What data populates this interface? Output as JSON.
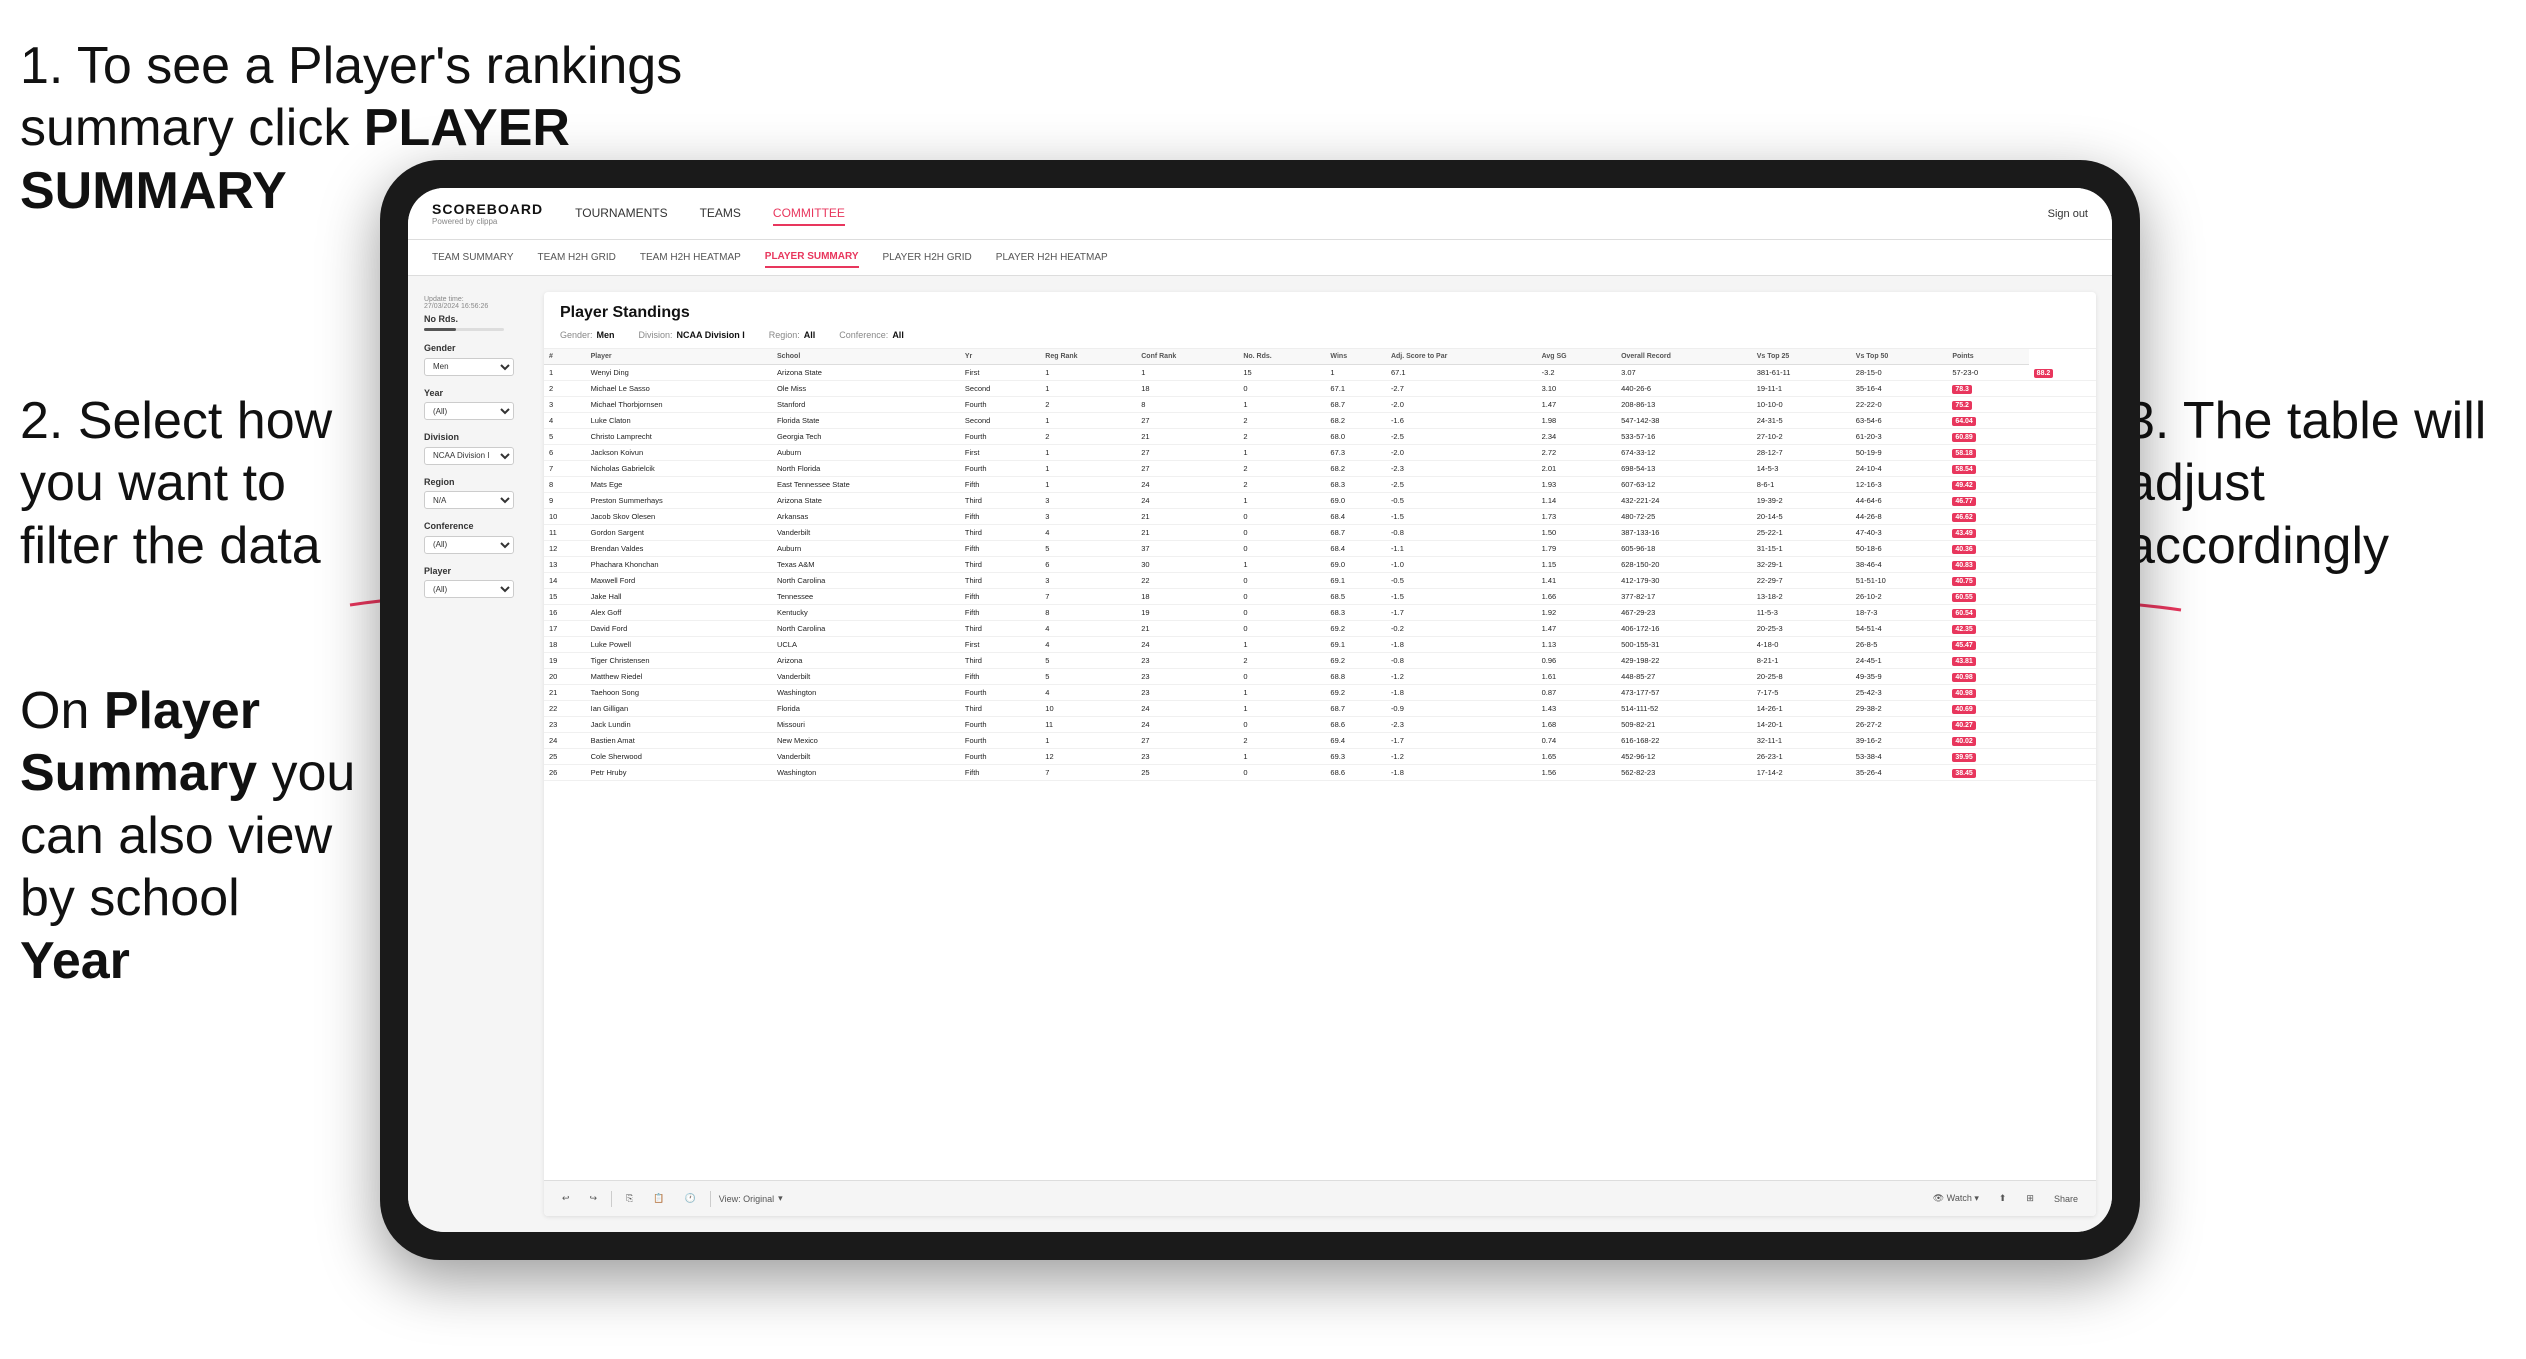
{
  "instructions": {
    "step1": "1. To see a Player's rankings summary click ",
    "step1_bold": "PLAYER SUMMARY",
    "step2_line1": "2. Select how you want to",
    "step2_line2": "filter the data",
    "step3": "3. The table will adjust accordingly",
    "step4_line1": "On ",
    "step4_bold1": "Player Summary",
    "step4_line2": " you can also view by school ",
    "step4_bold2": "Year"
  },
  "nav": {
    "logo": "SCOREBOARD",
    "logo_sub": "Powered by clippa",
    "links": [
      "TOURNAMENTS",
      "TEAMS",
      "COMMITTEE"
    ],
    "sign_out": "Sign out"
  },
  "sub_nav": {
    "links": [
      "TEAM SUMMARY",
      "TEAM H2H GRID",
      "TEAM H2H HEATMAP",
      "PLAYER SUMMARY",
      "PLAYER H2H GRID",
      "PLAYER H2H HEATMAP"
    ],
    "active": "PLAYER SUMMARY"
  },
  "update_time": {
    "label": "Update time:",
    "value": "27/03/2024 16:56:26"
  },
  "table": {
    "title": "Player Standings",
    "filters": {
      "gender_label": "Gender:",
      "gender_value": "Men",
      "division_label": "Division:",
      "division_value": "NCAA Division I",
      "region_label": "Region:",
      "region_value": "All",
      "conference_label": "Conference:",
      "conference_value": "All"
    },
    "columns": [
      "#",
      "Player",
      "School",
      "Yr",
      "Reg Rank",
      "Conf Rank",
      "No. Rds.",
      "Wins",
      "Adj. Score to Par",
      "Avg SG",
      "Overall Record",
      "Vs Top 25",
      "Vs Top 50",
      "Points"
    ],
    "rows": [
      [
        "1",
        "Wenyi Ding",
        "Arizona State",
        "First",
        "1",
        "1",
        "15",
        "1",
        "67.1",
        "-3.2",
        "3.07",
        "381-61-11",
        "28-15-0",
        "57-23-0",
        "88.2"
      ],
      [
        "2",
        "Michael Le Sasso",
        "Ole Miss",
        "Second",
        "1",
        "18",
        "0",
        "67.1",
        "-2.7",
        "3.10",
        "440-26-6",
        "19-11-1",
        "35-16-4",
        "78.3"
      ],
      [
        "3",
        "Michael Thorbjornsen",
        "Stanford",
        "Fourth",
        "2",
        "8",
        "1",
        "68.7",
        "-2.0",
        "1.47",
        "208-86-13",
        "10-10-0",
        "22-22-0",
        "75.2"
      ],
      [
        "4",
        "Luke Claton",
        "Florida State",
        "Second",
        "1",
        "27",
        "2",
        "68.2",
        "-1.6",
        "1.98",
        "547-142-38",
        "24-31-5",
        "63-54-6",
        "64.04"
      ],
      [
        "5",
        "Christo Lamprecht",
        "Georgia Tech",
        "Fourth",
        "2",
        "21",
        "2",
        "68.0",
        "-2.5",
        "2.34",
        "533-57-16",
        "27-10-2",
        "61-20-3",
        "60.89"
      ],
      [
        "6",
        "Jackson Koivun",
        "Auburn",
        "First",
        "1",
        "27",
        "1",
        "67.3",
        "-2.0",
        "2.72",
        "674-33-12",
        "28-12-7",
        "50-19-9",
        "58.18"
      ],
      [
        "7",
        "Nicholas Gabrielcik",
        "North Florida",
        "Fourth",
        "1",
        "27",
        "2",
        "68.2",
        "-2.3",
        "2.01",
        "698-54-13",
        "14-5-3",
        "24-10-4",
        "58.54"
      ],
      [
        "8",
        "Mats Ege",
        "East Tennessee State",
        "Fifth",
        "1",
        "24",
        "2",
        "68.3",
        "-2.5",
        "1.93",
        "607-63-12",
        "8-6-1",
        "12-16-3",
        "49.42"
      ],
      [
        "9",
        "Preston Summerhays",
        "Arizona State",
        "Third",
        "3",
        "24",
        "1",
        "69.0",
        "-0.5",
        "1.14",
        "432-221-24",
        "19-39-2",
        "44-64-6",
        "46.77"
      ],
      [
        "10",
        "Jacob Skov Olesen",
        "Arkansas",
        "Fifth",
        "3",
        "21",
        "0",
        "68.4",
        "-1.5",
        "1.73",
        "480-72-25",
        "20-14-5",
        "44-26-8",
        "46.62"
      ],
      [
        "11",
        "Gordon Sargent",
        "Vanderbilt",
        "Third",
        "4",
        "21",
        "0",
        "68.7",
        "-0.8",
        "1.50",
        "387-133-16",
        "25-22-1",
        "47-40-3",
        "43.49"
      ],
      [
        "12",
        "Brendan Valdes",
        "Auburn",
        "Fifth",
        "5",
        "37",
        "0",
        "68.4",
        "-1.1",
        "1.79",
        "605-96-18",
        "31-15-1",
        "50-18-6",
        "40.36"
      ],
      [
        "13",
        "Phachara Khonchan",
        "Texas A&M",
        "Third",
        "6",
        "30",
        "1",
        "69.0",
        "-1.0",
        "1.15",
        "628-150-20",
        "32-29-1",
        "38-46-4",
        "40.83"
      ],
      [
        "14",
        "Maxwell Ford",
        "North Carolina",
        "Third",
        "3",
        "22",
        "0",
        "69.1",
        "-0.5",
        "1.41",
        "412-179-30",
        "22-29-7",
        "51-51-10",
        "40.75"
      ],
      [
        "15",
        "Jake Hall",
        "Tennessee",
        "Fifth",
        "7",
        "18",
        "0",
        "68.5",
        "-1.5",
        "1.66",
        "377-82-17",
        "13-18-2",
        "26-10-2",
        "60.55"
      ],
      [
        "16",
        "Alex Goff",
        "Kentucky",
        "Fifth",
        "8",
        "19",
        "0",
        "68.3",
        "-1.7",
        "1.92",
        "467-29-23",
        "11-5-3",
        "18-7-3",
        "60.54"
      ],
      [
        "17",
        "David Ford",
        "North Carolina",
        "Third",
        "4",
        "21",
        "0",
        "69.2",
        "-0.2",
        "1.47",
        "406-172-16",
        "20-25-3",
        "54-51-4",
        "42.35"
      ],
      [
        "18",
        "Luke Powell",
        "UCLA",
        "First",
        "4",
        "24",
        "1",
        "69.1",
        "-1.8",
        "1.13",
        "500-155-31",
        "4-18-0",
        "26-8-5",
        "45.47"
      ],
      [
        "19",
        "Tiger Christensen",
        "Arizona",
        "Third",
        "5",
        "23",
        "2",
        "69.2",
        "-0.8",
        "0.96",
        "429-198-22",
        "8-21-1",
        "24-45-1",
        "43.81"
      ],
      [
        "20",
        "Matthew Riedel",
        "Vanderbilt",
        "Fifth",
        "5",
        "23",
        "0",
        "68.8",
        "-1.2",
        "1.61",
        "448-85-27",
        "20-25-8",
        "49-35-9",
        "40.98"
      ],
      [
        "21",
        "Taehoon Song",
        "Washington",
        "Fourth",
        "4",
        "23",
        "1",
        "69.2",
        "-1.8",
        "0.87",
        "473-177-57",
        "7-17-5",
        "25-42-3",
        "40.98"
      ],
      [
        "22",
        "Ian Gilligan",
        "Florida",
        "Third",
        "10",
        "24",
        "1",
        "68.7",
        "-0.9",
        "1.43",
        "514-111-52",
        "14-26-1",
        "29-38-2",
        "40.69"
      ],
      [
        "23",
        "Jack Lundin",
        "Missouri",
        "Fourth",
        "11",
        "24",
        "0",
        "68.6",
        "-2.3",
        "1.68",
        "509-82-21",
        "14-20-1",
        "26-27-2",
        "40.27"
      ],
      [
        "24",
        "Bastien Amat",
        "New Mexico",
        "Fourth",
        "1",
        "27",
        "2",
        "69.4",
        "-1.7",
        "0.74",
        "616-168-22",
        "32-11-1",
        "39-16-2",
        "40.02"
      ],
      [
        "25",
        "Cole Sherwood",
        "Vanderbilt",
        "Fourth",
        "12",
        "23",
        "1",
        "69.3",
        "-1.2",
        "1.65",
        "452-96-12",
        "26-23-1",
        "53-38-4",
        "39.95"
      ],
      [
        "26",
        "Petr Hruby",
        "Washington",
        "Fifth",
        "7",
        "25",
        "0",
        "68.6",
        "-1.8",
        "1.56",
        "562-82-23",
        "17-14-2",
        "35-26-4",
        "38.45"
      ]
    ]
  },
  "sidebar": {
    "no_rds_label": "No Rds.",
    "gender_label": "Gender",
    "gender_value": "Men",
    "year_label": "Year",
    "year_value": "(All)",
    "division_label": "Division",
    "division_value": "NCAA Division I",
    "region_label": "Region",
    "region_value": "N/A",
    "conference_label": "Conference",
    "conference_value": "(All)",
    "player_label": "Player",
    "player_value": "(All)"
  },
  "toolbar": {
    "view_label": "View: Original",
    "watch_label": "Watch",
    "share_label": "Share"
  }
}
